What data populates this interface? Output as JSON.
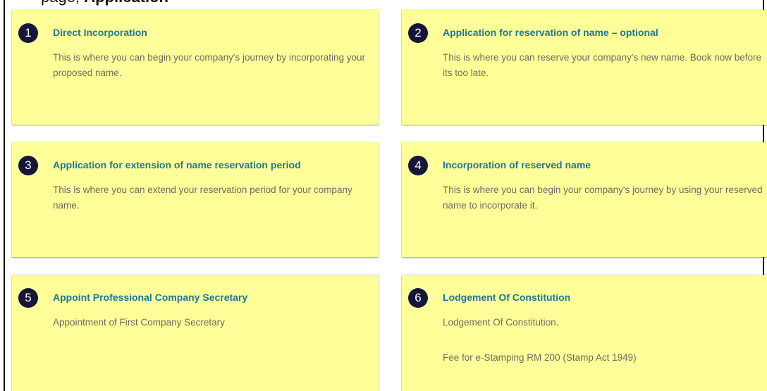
{
  "header": {
    "caption_prefix": "page,",
    "caption_bold": "Application"
  },
  "cards": [
    {
      "number": "1",
      "title": "Direct Incorporation",
      "description": "This is where you can begin your company's journey by incorporating your proposed name."
    },
    {
      "number": "2",
      "title": "Application for reservation of name – optional",
      "description": "This is where you can reserve your company's new name. Book now before its too late."
    },
    {
      "number": "3",
      "title": "Application for extension of name reservation period",
      "description": "This is where you can extend your reservation period for your company name."
    },
    {
      "number": "4",
      "title": "Incorporation of reserved name",
      "description": "This is where you can begin your company's journey by using your reserved name to incorporate it."
    },
    {
      "number": "5",
      "title": "Appoint Professional Company Secretary",
      "description": "Appointment of First Company Secretary"
    },
    {
      "number": "6",
      "title": "Lodgement Of Constitution",
      "description": "Lodgement Of Constitution.",
      "extra": "Fee for e-Stamping RM 200 (Stamp Act 1949)"
    }
  ],
  "colors": {
    "card_bg": "#ffff99",
    "badge_bg": "#16163a",
    "title": "#16799e",
    "body_text": "#6b6b62"
  }
}
